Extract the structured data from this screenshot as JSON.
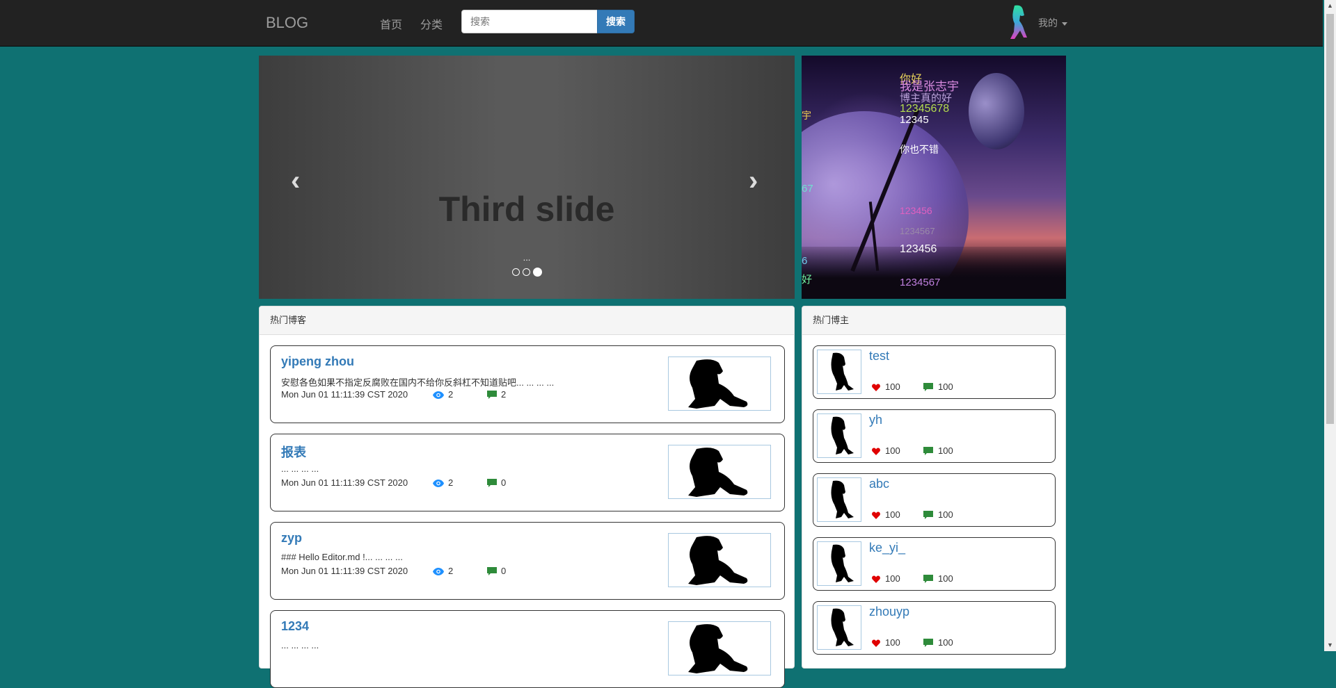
{
  "navbar": {
    "brand": "BLOG",
    "links": [
      {
        "label": "首页"
      },
      {
        "label": "分类"
      }
    ],
    "search_placeholder": "搜索",
    "search_button": "搜索",
    "user_menu": "我的"
  },
  "carousel": {
    "slide_title": "Third slide",
    "caption": "...",
    "indicators": 3,
    "active_index": 2
  },
  "danmaku": [
    {
      "text": "你好",
      "color": "#e9d35a"
    },
    {
      "text": "我是张志宇",
      "color": "#d98adf"
    },
    {
      "text": "博主真的好",
      "color": "#b9a0d8"
    },
    {
      "text": "12345678",
      "color": "#b5dd4f"
    },
    {
      "text": "12345",
      "color": "#ffffff"
    },
    {
      "text": "你也不错",
      "color": "#ffffff"
    },
    {
      "text": "123456",
      "color": "#e060c0"
    },
    {
      "text": "1234567",
      "color": "#9a8aa8"
    },
    {
      "text": "123456",
      "color": "#ffffff"
    },
    {
      "text": "1234567",
      "color": "#c080e0"
    },
    {
      "text": "宇",
      "color": "#f0d050"
    },
    {
      "text": "67",
      "color": "#70e0d0"
    },
    {
      "text": "6",
      "color": "#70d0f0"
    },
    {
      "text": "好",
      "color": "#70f0a0"
    }
  ],
  "hot_blogs": {
    "heading": "热门博客",
    "items": [
      {
        "title": "yipeng zhou",
        "summary": "安慰各色如果不指定反腐败在国内不给你反斜杠不知道贴吧... ... ... ...",
        "date": "Mon Jun 01 11:11:39 CST 2020",
        "views": "2",
        "comments": "2"
      },
      {
        "title": "报表",
        "summary": "... ... ... ...",
        "date": "Mon Jun 01 11:11:39 CST 2020",
        "views": "2",
        "comments": "0"
      },
      {
        "title": "zyp",
        "summary": "### Hello Editor.md !... ... ... ...",
        "date": "Mon Jun 01 11:11:39 CST 2020",
        "views": "2",
        "comments": "0"
      },
      {
        "title": "1234",
        "summary": "... ... ... ...",
        "date": "",
        "views": "",
        "comments": ""
      }
    ]
  },
  "hot_bloggers": {
    "heading": "热门博主",
    "items": [
      {
        "name": "test",
        "likes": "100",
        "comments": "100"
      },
      {
        "name": "yh",
        "likes": "100",
        "comments": "100"
      },
      {
        "name": "abc",
        "likes": "100",
        "comments": "100"
      },
      {
        "name": "ke_yi_",
        "likes": "100",
        "comments": "100"
      },
      {
        "name": "zhouyp",
        "likes": "100",
        "comments": "100"
      }
    ]
  },
  "colors": {
    "page_bg": "#0f7172",
    "navbar_bg": "#222222",
    "link": "#337ab7",
    "heart": "#e00000",
    "comment": "#2e8b3a",
    "eye": "#1e90ff"
  }
}
